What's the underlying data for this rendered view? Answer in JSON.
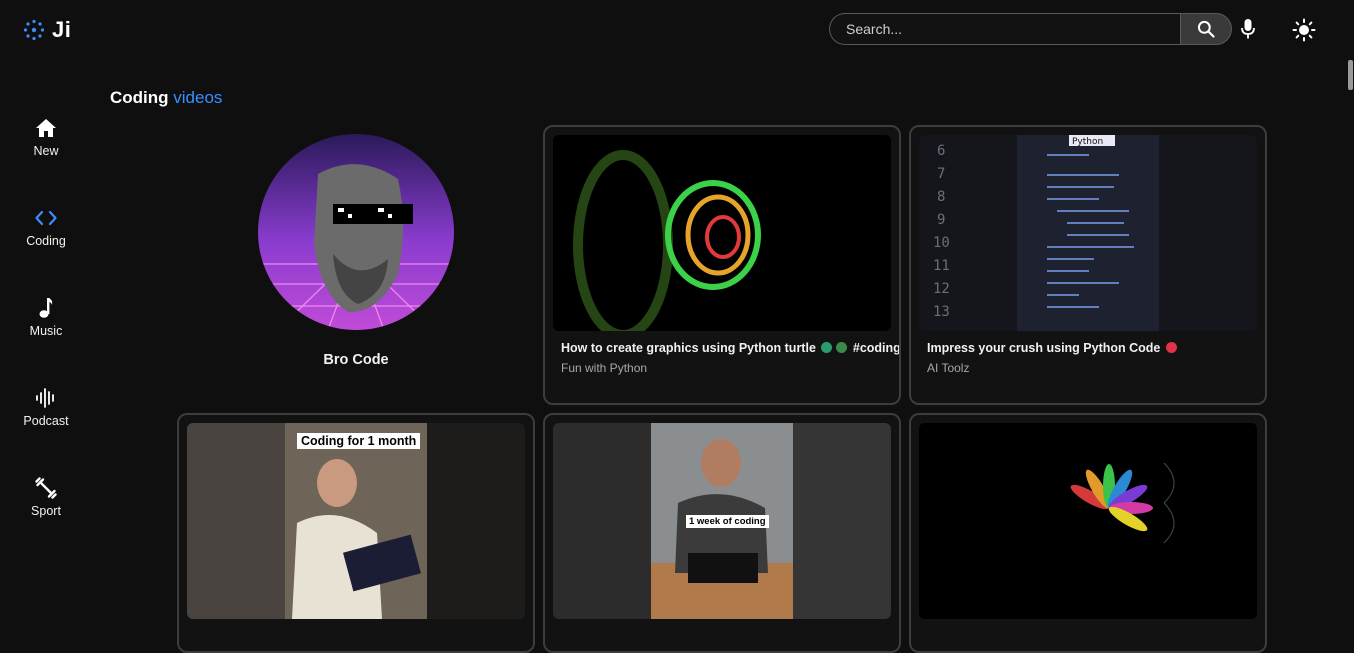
{
  "brand": {
    "logo_text": "Ji",
    "accent": "#3a8eff"
  },
  "header": {
    "search_placeholder": "Search...",
    "search_button_icon": "search-icon",
    "mic_icon": "microphone-icon",
    "theme_icon": "sun-icon"
  },
  "sidebar": {
    "items": [
      {
        "label": "New",
        "icon": "home-icon"
      },
      {
        "label": "Coding",
        "icon": "code-icon"
      },
      {
        "label": "Music",
        "icon": "music-note-icon"
      },
      {
        "label": "Podcast",
        "icon": "audio-wave-icon"
      },
      {
        "label": "Sport",
        "icon": "dumbbell-icon"
      }
    ]
  },
  "main": {
    "section_title": "Coding",
    "section_title_accent": "videos",
    "channel": {
      "name": "Bro Code"
    },
    "videos": [
      {
        "title": "How to create graphics using Python turtle",
        "title_tag": "#coding",
        "channel": "Fun with Python"
      },
      {
        "title": "Impress your crush using Python Code",
        "channel": "AI Toolz",
        "overlay": "Python"
      },
      {
        "title": "",
        "channel": "",
        "overlay": "Coding for 1 month"
      },
      {
        "title": "",
        "channel": "",
        "overlay": "1 week of coding"
      },
      {
        "title": "",
        "channel": ""
      }
    ]
  }
}
